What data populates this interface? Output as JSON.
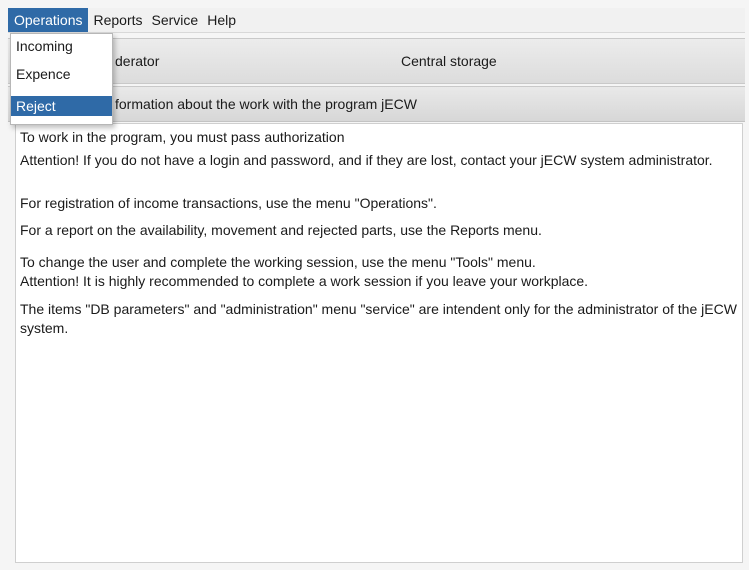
{
  "menubar": {
    "items": [
      "Operations",
      "Reports",
      "Service",
      "Help"
    ]
  },
  "dropdown": {
    "items": [
      "Incoming",
      "Expence",
      "Reject"
    ]
  },
  "header": {
    "operator_label": "derator",
    "storage_label": "Central storage"
  },
  "info": {
    "text": "formation about the work with the program jECW"
  },
  "content": {
    "paragraphs": [
      "To work in the program, you must pass authorization",
      "Attention! If you do not have a login and password, and if they are lost, contact your jECW system administrator.",
      "For registration of income transactions, use the menu \"Operations\".",
      "For a report on the availability, movement and rejected parts, use the Reports menu.",
      "To change the user and complete the working session, use the menu \"Tools\" menu.",
      "Attention! It is highly recommended to complete a work session if you leave your workplace.",
      "The items \"DB parameters\" and \"administration\" menu \"service\" are intendent only for the administrator of the jECW system."
    ]
  },
  "colors": {
    "accent": "#2f6aa7",
    "header_bg": "#e2e2e2",
    "content_bg": "#ffffff"
  }
}
